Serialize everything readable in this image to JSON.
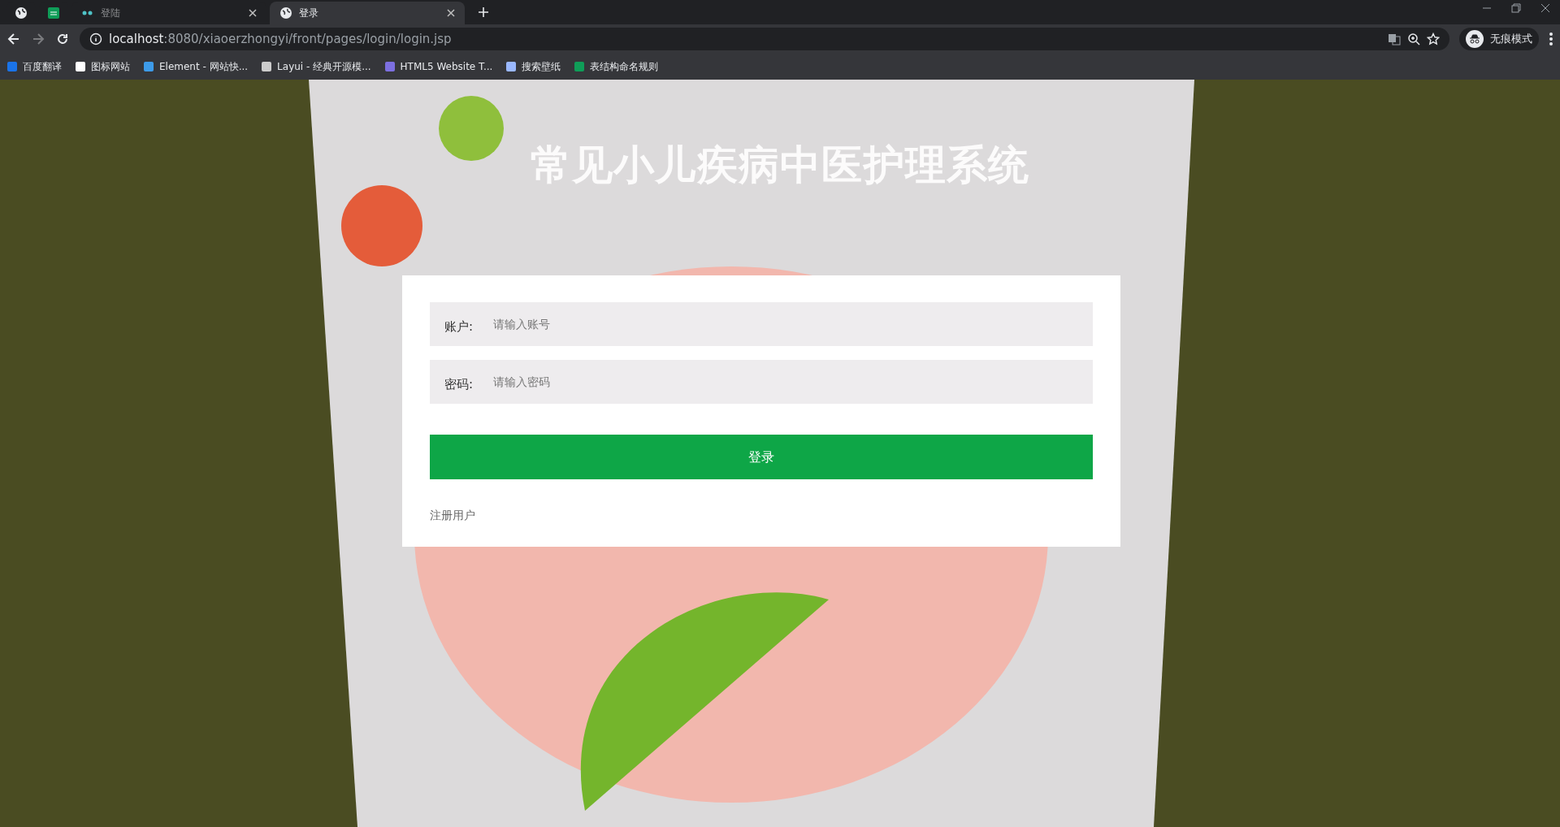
{
  "browser": {
    "tabs": [
      {
        "kind": "pinned",
        "selected": false
      },
      {
        "kind": "pinned-app",
        "selected": false
      },
      {
        "kind": "tab",
        "title": "登陆",
        "selected": false
      },
      {
        "kind": "tab",
        "title": "登录",
        "selected": true
      }
    ],
    "address": {
      "host": "localhost",
      "rest": ":8080/xiaoerzhongyi/front/pages/login/login.jsp"
    },
    "profile": "无痕模式",
    "bookmarks": [
      "百度翻译",
      "图标网站",
      "Element - 网站快...",
      "Layui - 经典开源模...",
      "HTML5 Website T...",
      "搜索壁纸",
      "表结构命名规则"
    ]
  },
  "page": {
    "title": "常见小儿疾病中医护理系统",
    "fields": [
      {
        "label": "账户:",
        "placeholder": "请输入账号"
      },
      {
        "label": "密码:",
        "placeholder": "请输入密码"
      }
    ],
    "submit": "登录",
    "register_link": "注册用户"
  }
}
